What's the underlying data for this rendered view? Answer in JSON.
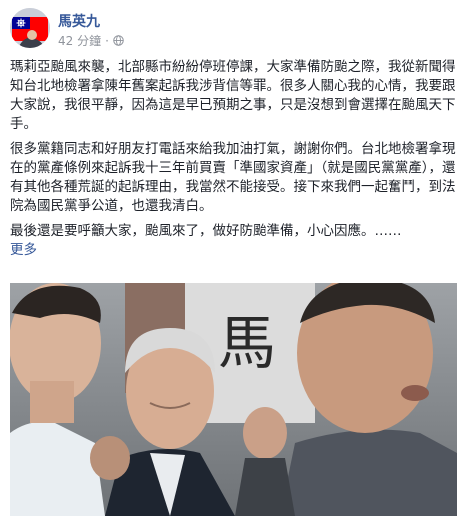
{
  "post": {
    "author": "馬英九",
    "timestamp": "42 分鐘",
    "privacy_icon": "globe-icon",
    "paragraphs": [
      "瑪莉亞颱風來襲，北部縣市紛紛停班停課，大家準備防颱之際，我從新聞得知台北地檢署拿陳年舊案起訴我涉背信等罪。很多人關心我的心情，我要跟大家說，我很平靜，因為這是早已預期之事，只是沒想到會選擇在颱風天下手。",
      "很多黨籍同志和好朋友打電話來給我加油打氣，謝謝你們。台北地檢署拿現在的黨產條例來起訴我十三年前買賣「準國家資產」（就是國民黨黨產），還有其他各種荒誕的起訴理由，我當然不能接受。接下來我們一起奮鬥，到法院為國民黨爭公道，也還我清白。",
      "最後還是要呼籲大家，颱風來了，做好防颱準備，小心因應。……"
    ],
    "see_more": "更多",
    "photo_sign_text": "馬"
  },
  "colors": {
    "link": "#365899",
    "text": "#1d2129",
    "meta": "#90949c",
    "flag_red": "#fe0000",
    "flag_blue": "#000095"
  }
}
